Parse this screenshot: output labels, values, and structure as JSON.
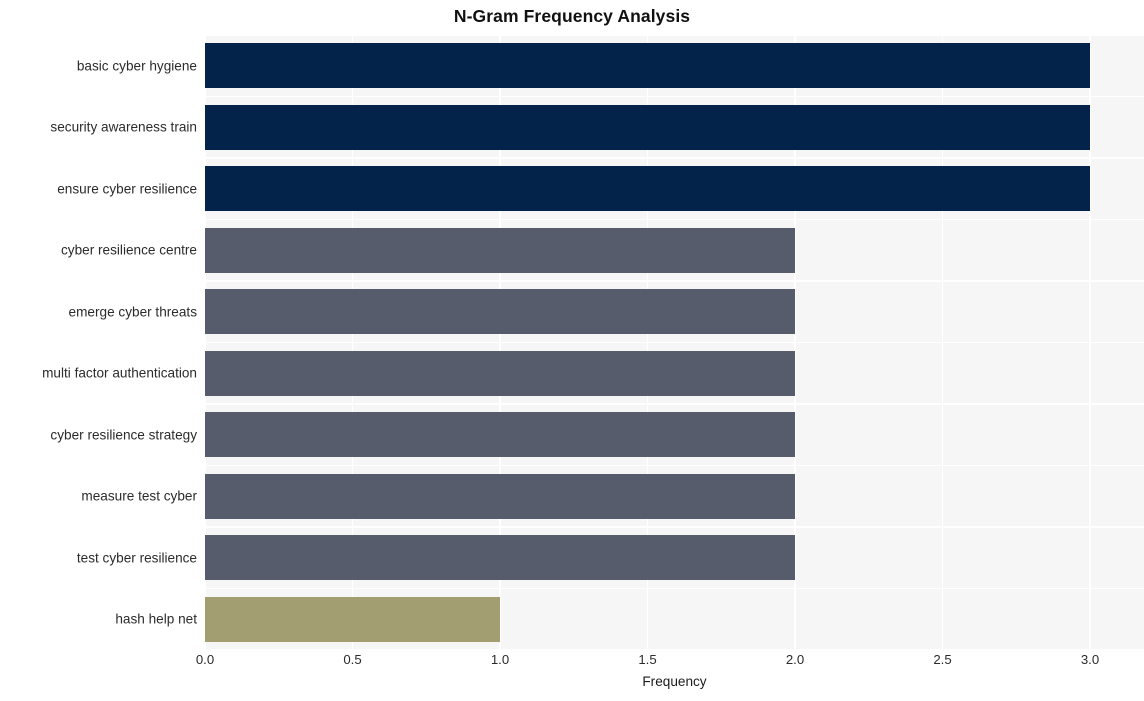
{
  "chart_data": {
    "type": "bar",
    "orientation": "horizontal",
    "title": "N-Gram Frequency Analysis",
    "xlabel": "Frequency",
    "ylabel": "",
    "categories": [
      "basic cyber hygiene",
      "security awareness train",
      "ensure cyber resilience",
      "cyber resilience centre",
      "emerge cyber threats",
      "multi factor authentication",
      "cyber resilience strategy",
      "measure test cyber",
      "test cyber resilience",
      "hash help net"
    ],
    "values": [
      3,
      3,
      3,
      2,
      2,
      2,
      2,
      2,
      2,
      1
    ],
    "bar_colors": [
      "#04234b",
      "#04234b",
      "#04234b",
      "#575c6c",
      "#575c6c",
      "#575c6c",
      "#575c6c",
      "#575c6c",
      "#575c6c",
      "#a39d72"
    ],
    "xlim": [
      0.0,
      3.0
    ],
    "xticks": [
      0.0,
      0.5,
      1.0,
      1.5,
      2.0,
      2.5,
      3.0
    ],
    "xtick_labels": [
      "0.0",
      "0.5",
      "1.0",
      "1.5",
      "2.0",
      "2.5",
      "3.0"
    ],
    "grid": true,
    "grid_color": "#ffffff",
    "plot_background": "#f6f6f7",
    "figure_background": "#ffffff",
    "legend": null
  }
}
